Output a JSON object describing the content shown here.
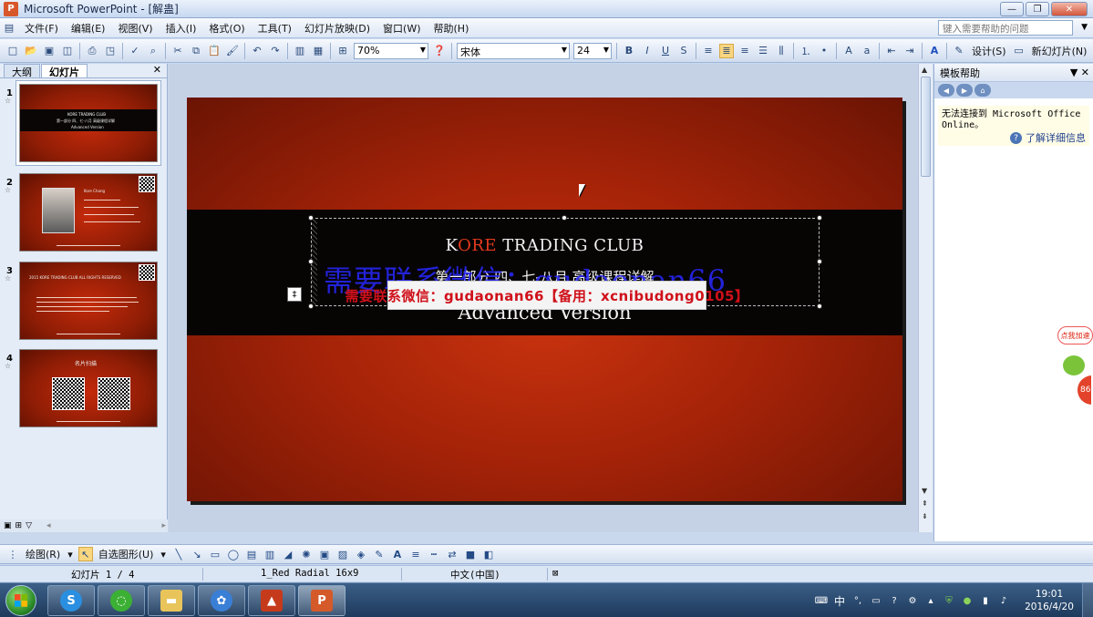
{
  "window": {
    "title": "Microsoft PowerPoint - [解蛊]",
    "buttons": {
      "minimize": "—",
      "restore": "❐",
      "close": "✕"
    }
  },
  "menu": {
    "items": [
      "文件(F)",
      "编辑(E)",
      "视图(V)",
      "插入(I)",
      "格式(O)",
      "工具(T)",
      "幻灯片放映(D)",
      "窗口(W)",
      "帮助(H)"
    ],
    "help_search_placeholder": "键入需要帮助的问题"
  },
  "toolbar": {
    "zoom": "70%",
    "font_name": "宋体",
    "font_size": "24",
    "bold": "B",
    "italic": "I",
    "underline": "U",
    "shadow": "S",
    "design_label": "设计(S)",
    "new_slide_label": "新幻灯片(N)"
  },
  "left_pane": {
    "tabs": [
      "大纲",
      "幻灯片"
    ],
    "active_tab": "幻灯片",
    "slides": [
      {
        "number": "1",
        "title": "KORE TRADING CLUB",
        "subtitle": "第一部分 四、七-八月 高级课程详解",
        "line3": "Advanced Version"
      },
      {
        "number": "2",
        "title": "Kore Chang",
        "qr": true
      },
      {
        "number": "3",
        "title": "2015 KORE TRADING CLUB ALL RIGHTS RESERVED",
        "qr": true
      },
      {
        "number": "4",
        "title": "名片扫描",
        "qr": true
      }
    ]
  },
  "slide": {
    "title_prefix": "K",
    "title_accent": "ORE",
    "title_suffix": " TRADING CLUB",
    "subtitle": "第一部分 四、七-八月 高级课程详解",
    "line3": "Advanced Version",
    "watermark_blue": "需要联系微信：gudaonan66",
    "watermark_box": "需要联系微信：gudaonan66【备用：xcnibudong0105】"
  },
  "task_pane": {
    "title": "模板帮助",
    "message": "无法连接到 Microsoft Office Online。",
    "link": "了解详细信息"
  },
  "floating_widget": {
    "badge": "点我加速",
    "ball_text": "86"
  },
  "draw_toolbar": {
    "draw_label": "绘图(R)",
    "autoshapes_label": "自选图形(U)"
  },
  "status_bar": {
    "slide_info": "幻灯片 1 / 4",
    "template": "1_Red Radial 16x9",
    "language": "中文(中国)"
  },
  "taskbar": {
    "apps": [
      "sogou",
      "wechat",
      "explorer",
      "flower",
      "chart",
      "powerpoint"
    ],
    "ime": "中",
    "time": "19:01",
    "date": "2016/4/20"
  },
  "colors": {
    "accent": "#e23a1c",
    "slide_bg": "#a52308",
    "band": "#070404"
  }
}
